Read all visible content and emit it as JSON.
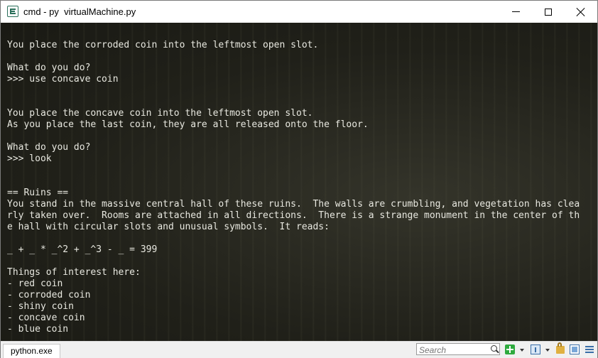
{
  "window": {
    "title": "cmd - py  virtualMachine.py"
  },
  "console": {
    "lines": [
      "You place the corroded coin into the leftmost open slot.",
      "",
      "What do you do?",
      ">>> use concave coin",
      "",
      "",
      "You place the concave coin into the leftmost open slot.",
      "As you place the last coin, they are all released onto the floor.",
      "",
      "What do you do?",
      ">>> look",
      "",
      "",
      "== Ruins ==",
      "You stand in the massive central hall of these ruins.  The walls are crumbling, and vegetation has clea",
      "rly taken over.  Rooms are attached in all directions.  There is a strange monument in the center of th",
      "e hall with circular slots and unusual symbols.  It reads:",
      "",
      "_ + _ * _^2 + _^3 - _ = 399",
      "",
      "Things of interest here:",
      "- red coin",
      "- corroded coin",
      "- shiny coin",
      "- concave coin",
      "- blue coin"
    ]
  },
  "statusbar": {
    "tab_label": "python.exe",
    "search_placeholder": "Search"
  }
}
